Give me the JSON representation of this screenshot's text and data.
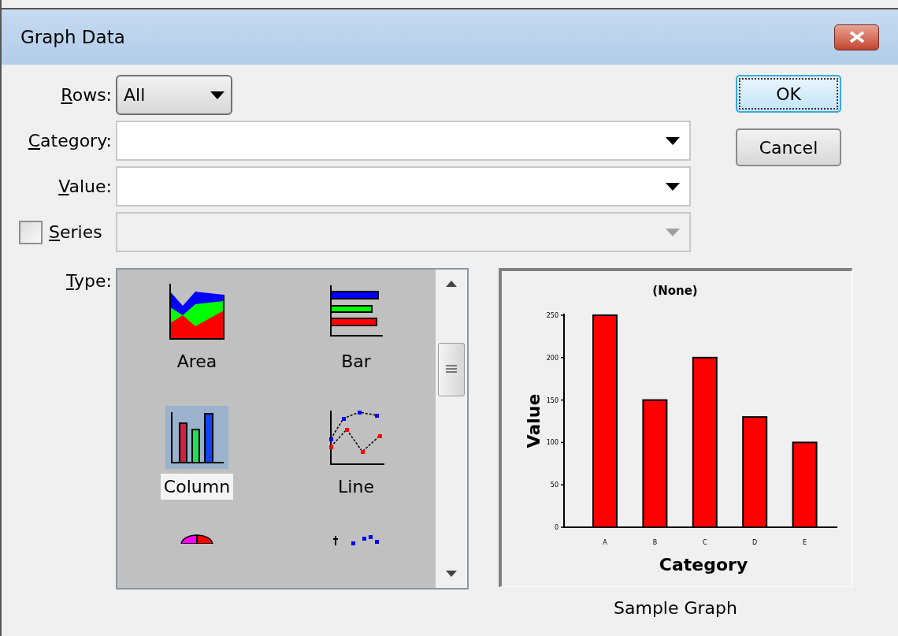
{
  "window": {
    "title": "Graph Data"
  },
  "fields": [
    {
      "kind": "select",
      "label": "Rows:",
      "value": "All"
    },
    {
      "kind": "combo",
      "label": "Category:"
    },
    {
      "kind": "combo",
      "label": "Value:"
    },
    {
      "kind": "check_combo",
      "label": "Series",
      "checked": false,
      "disabled": true
    }
  ],
  "buttons": [
    {
      "label": "OK",
      "default": true
    },
    {
      "label": "Cancel",
      "default": false
    }
  ],
  "type": {
    "label": "Type:",
    "items": [
      {
        "kind": "area",
        "label": "Area",
        "selected": false
      },
      {
        "kind": "bar",
        "label": "Bar",
        "selected": false
      },
      {
        "kind": "column",
        "label": "Column",
        "selected": true
      },
      {
        "kind": "line",
        "label": "Line",
        "selected": false
      },
      {
        "kind": "pie",
        "selected": false
      },
      {
        "kind": "scatter",
        "selected": false
      }
    ]
  },
  "sample": {
    "caption": "Sample Graph",
    "chart_data": {
      "type": "bar",
      "title": "(None)",
      "xlabel": "Category",
      "ylabel": "Value",
      "categories": [
        "A",
        "B",
        "C",
        "D",
        "E"
      ],
      "series": [
        {
          "color": "#ff0000",
          "values": [
            250,
            150,
            200,
            130,
            100
          ]
        }
      ],
      "ylim": [
        0,
        250
      ],
      "yticks": [
        0,
        50,
        100,
        150,
        200,
        250
      ]
    }
  }
}
